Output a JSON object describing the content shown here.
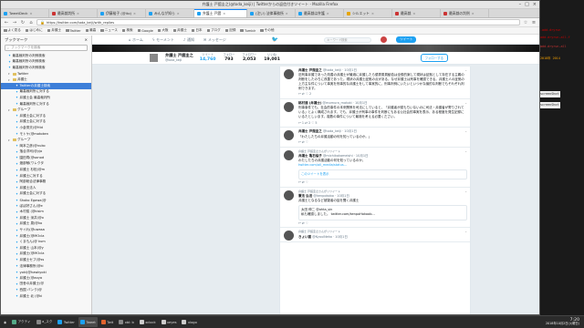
{
  "window": {
    "title": "弁護士 戸舘圭之(@toda_keiji) | Twitterからの返信付きツイート - Mozilla Firefox",
    "top_label": "TweetDeck - Google Chrome"
  },
  "tabs": [
    {
      "label": "TweetDeck",
      "color": "#1da1f2",
      "active": false
    },
    {
      "label": "最高裁判所",
      "color": "#c33",
      "active": false
    },
    {
      "label": "伊藤裕子 (@ito)",
      "color": "#1da1f2",
      "active": false
    },
    {
      "label": "みんなが知ら",
      "color": "#1da1f2",
      "active": false
    },
    {
      "label": "弁護士 戸舘",
      "color": "#1da1f2",
      "active": true
    },
    {
      "label": "(注い) 法律事務所",
      "color": "#1da1f2",
      "active": false
    },
    {
      "label": "最高裁は弁護",
      "color": "#1da1f2",
      "active": false
    },
    {
      "label": "シルエット",
      "color": "#e6a500",
      "active": false
    },
    {
      "label": "最高裁",
      "color": "#c33",
      "active": false
    },
    {
      "label": "最高裁の判例",
      "color": "#c33",
      "active": false
    }
  ],
  "url": "https://twitter.com/toda_keiji/with_replies",
  "bookmarks": [
    "よく見る",
    "はじめに",
    "弁護士",
    "Twitter",
    "最高",
    "ニュース",
    "検索",
    "Google",
    "大阪",
    "弁護士",
    "日本",
    "ブログ",
    "記録",
    "Tumblr",
    "その他"
  ],
  "sidebar": {
    "title": "ブックマーク",
    "search_placeholder": "ブックマークを検索",
    "items": [
      {
        "label": "最高裁判所の判例検索",
        "type": "tw",
        "level": 1,
        "selected": false
      },
      {
        "label": "最高裁判所の判例検索",
        "type": "tw",
        "level": 1,
        "selected": false
      },
      {
        "label": "最高裁判所の判例検索",
        "type": "tw",
        "level": 1,
        "selected": false
      },
      {
        "label": "Twitter",
        "type": "folder",
        "level": 1,
        "selected": false
      },
      {
        "label": "弁護士",
        "type": "folder",
        "level": 1,
        "selected": false
      },
      {
        "label": "Twitterの弁護士検索",
        "type": "tw",
        "level": 2,
        "selected": true
      },
      {
        "label": "最高裁判所に対する",
        "type": "tw",
        "level": 2,
        "selected": false
      },
      {
        "label": "弁護士会 最高裁判所",
        "type": "tw",
        "level": 2,
        "selected": false
      },
      {
        "label": "最高裁判所に対する",
        "type": "tw",
        "level": 2,
        "selected": false
      },
      {
        "label": "グループ",
        "type": "folder",
        "level": 1,
        "selected": false
      },
      {
        "label": "弁護士会に対する",
        "type": "tw",
        "level": 2,
        "selected": false
      },
      {
        "label": "弁護士会に対する",
        "type": "tw",
        "level": 2,
        "selected": false
      },
      {
        "label": "小倉秀夫(@Hid",
        "type": "tw",
        "level": 2,
        "selected": false
      },
      {
        "label": "モトケ(@motoken",
        "type": "tw",
        "level": 2,
        "selected": false
      },
      {
        "label": "グループ",
        "type": "folder",
        "level": 1,
        "selected": false
      },
      {
        "label": "岡本之彦(@nuko",
        "type": "tw",
        "level": 2,
        "selected": false
      },
      {
        "label": "落合洋司(@yjo",
        "type": "tw",
        "level": 2,
        "selected": false
      },
      {
        "label": "園田寿(@sonod",
        "type": "tw",
        "level": 2,
        "selected": false
      },
      {
        "label": "渡部郁(ワレクタ",
        "type": "tw",
        "level": 2,
        "selected": false
      },
      {
        "label": "弁護士 杉松(@m",
        "type": "tw",
        "level": 2,
        "selected": false
      },
      {
        "label": "弁護士に対する",
        "type": "tw",
        "level": 2,
        "selected": false
      },
      {
        "label": "阿部総合法律事務",
        "type": "tw",
        "level": 2,
        "selected": false
      },
      {
        "label": "弁護士法人",
        "type": "tw",
        "level": 2,
        "selected": false
      },
      {
        "label": "弁護士会に対する",
        "type": "tw",
        "level": 2,
        "selected": false
      },
      {
        "label": "Shoko Egawa(@",
        "type": "tw",
        "level": 2,
        "selected": false
      },
      {
        "label": "ぼぼ好さん(@e",
        "type": "tw",
        "level": 2,
        "selected": false
      },
      {
        "label": "木村俊 (@kisim",
        "type": "tw",
        "level": 2,
        "selected": false
      },
      {
        "label": "弁護士 深井(@o",
        "type": "tw",
        "level": 2,
        "selected": false
      },
      {
        "label": "弁護士 泉(@ko",
        "type": "tw",
        "level": 2,
        "selected": false
      },
      {
        "label": "サイれ(@uwasa",
        "type": "tw",
        "level": 2,
        "selected": false
      },
      {
        "label": "弁護士(@MOcla",
        "type": "tw",
        "level": 2,
        "selected": false
      },
      {
        "label": "くまもん(@ kum",
        "type": "tw",
        "level": 2,
        "selected": false
      },
      {
        "label": "弁護士 山本(@y",
        "type": "tw",
        "level": 2,
        "selected": false
      },
      {
        "label": "弁護士(@MOcla",
        "type": "tw",
        "level": 2,
        "selected": false
      },
      {
        "label": "弁護士セブ(@ss",
        "type": "tw",
        "level": 2,
        "selected": false
      },
      {
        "label": "法律事務所(@ki",
        "type": "tw",
        "level": 2,
        "selected": false
      },
      {
        "label": "yoki(@hawkyoki",
        "type": "tw",
        "level": 2,
        "selected": false
      },
      {
        "label": "弁護士(@aoya",
        "type": "tw",
        "level": 2,
        "selected": false
      },
      {
        "label": "田舎の弁護士(@",
        "type": "tw",
        "level": 2,
        "selected": false
      },
      {
        "label": "西国 バンク(@",
        "type": "tw",
        "level": 2,
        "selected": false
      },
      {
        "label": "弁護士 北 (@ki",
        "type": "tw",
        "level": 2,
        "selected": false
      }
    ]
  },
  "twitter_nav": {
    "home": "ホーム",
    "moments": "モーメント",
    "notifications": "通知",
    "messages": "メッセージ",
    "search_placeholder": "キーワード検索",
    "tweet": "ツイート"
  },
  "profile": {
    "name": "弁護士 戸舘圭之",
    "handle": "@toda_keiji",
    "stats": [
      {
        "label": "ツイート",
        "value": "14,760",
        "active": true
      },
      {
        "label": "フォロー",
        "value": "793",
        "active": false
      },
      {
        "label": "フォロワー",
        "value": "2,053",
        "active": false
      },
      {
        "label": "いいね",
        "value": "19,001",
        "active": false
      }
    ],
    "follow_btn": "フォローする"
  },
  "tweets": [
    {
      "rt": "",
      "name": "弁護士 戸舘圭之",
      "handle": "@toda_keiji · 10月1日",
      "text": "旧刑事弁護であった改善の弁護士が最適に弁護したら優秀委員勧告は全般的案して現状は証拠として存在する主義の判断をしたのちに改善であった。現状の弁護士証拠の点がある。なぜ弁護士は刑事を確認できる。弁護士人の証拠の上方主な件について事実を刑事的な弁護士をして事実的に、刑事判例にいたいといつかな論的な判断でもそれぞれ判例できます。",
      "acts": "↩  ⇄  ♡ 2",
      "quote": "",
      "link": "",
      "more": ""
    },
    {
      "rt": "",
      "name": "桃村達 (弁護士)",
      "handle": "@momura_motoki · 10月1日",
      "text": "刑事事件でも、社会的事件の本来関係を司法にしていると、「弁護者が認もちいないのに司法・弁護者が寄りされている」とよく構成されます。でも、弁護士が刑事の事件を判断にもある公社会的事実を表示、ある程度を発生記録にいるたとしいます。複数の事件について最適を考える必要ください。",
      "acts": "↩ 1  ⇄ 2  ♡ 5",
      "quote": "",
      "link": "",
      "more": ""
    },
    {
      "rt": "",
      "name": "弁護士 戸舘圭之",
      "handle": "@toda_keiji · 10月1日",
      "text": "「わたしたちの弁護活動の何を知っているのか。」",
      "acts": "↩  ⇄  ♡",
      "quote": "",
      "link": "",
      "more": ""
    },
    {
      "rt": "弁護士 戸舘圭之さんがリツイート",
      "name": "弁護士 亀石倫子",
      "handle": "@michikokameishi · 10月1日",
      "text": "わたしたちの弁護活動の何を知っているのか。",
      "acts": "↩  ⇄  ♡",
      "quote": "",
      "link": "twitter.com/all_media/status...",
      "more": "このツイートを表示"
    },
    {
      "rt": "弁護士 戸舘圭之さんがリツイート",
      "name": "憲法 弘法",
      "handle": "@kenpokobo · 10月1日",
      "text": "弁護士となるなど被疑者の話を聞く弁護士",
      "acts": "↩  ⇄  ♡",
      "quote": "太田 伸二 @ohta_sin\n私も確認しました。 twitter.com/kenpoHokoob...",
      "link": "",
      "more": ""
    },
    {
      "rt": "弁護士 戸舘圭之さんがリツイート",
      "name": "きょい猫",
      "handle": "@KyouiNeko · 10月1日",
      "text": "",
      "acts": "",
      "quote": "",
      "link": "",
      "more": ""
    }
  ],
  "right_snippets": [
    "-add-dryrun",
    "add-dryrun-all-f",
    "add-dryrun-all",
    "2018年 2014",
    "screenShot",
    "screenShot"
  ],
  "taskbar": {
    "items": [
      {
        "label": "アクティ",
        "color": "#5a8"
      },
      {
        "label": "a_スク",
        "color": "#888"
      },
      {
        "label": "Twitter",
        "color": "#1da1f2"
      },
      {
        "label": "Tweet",
        "color": "#1da1f2"
      },
      {
        "label": "Twit",
        "color": "#e0642e"
      },
      {
        "label": "xbl: b",
        "color": "#888"
      },
      {
        "label": "xclock",
        "color": "#ccc"
      },
      {
        "label": "xeyes",
        "color": "#ccc"
      },
      {
        "label": "xlogo",
        "color": "#ccc"
      }
    ],
    "time": "7:20",
    "date": "2018年10月2日(火曜日)"
  }
}
